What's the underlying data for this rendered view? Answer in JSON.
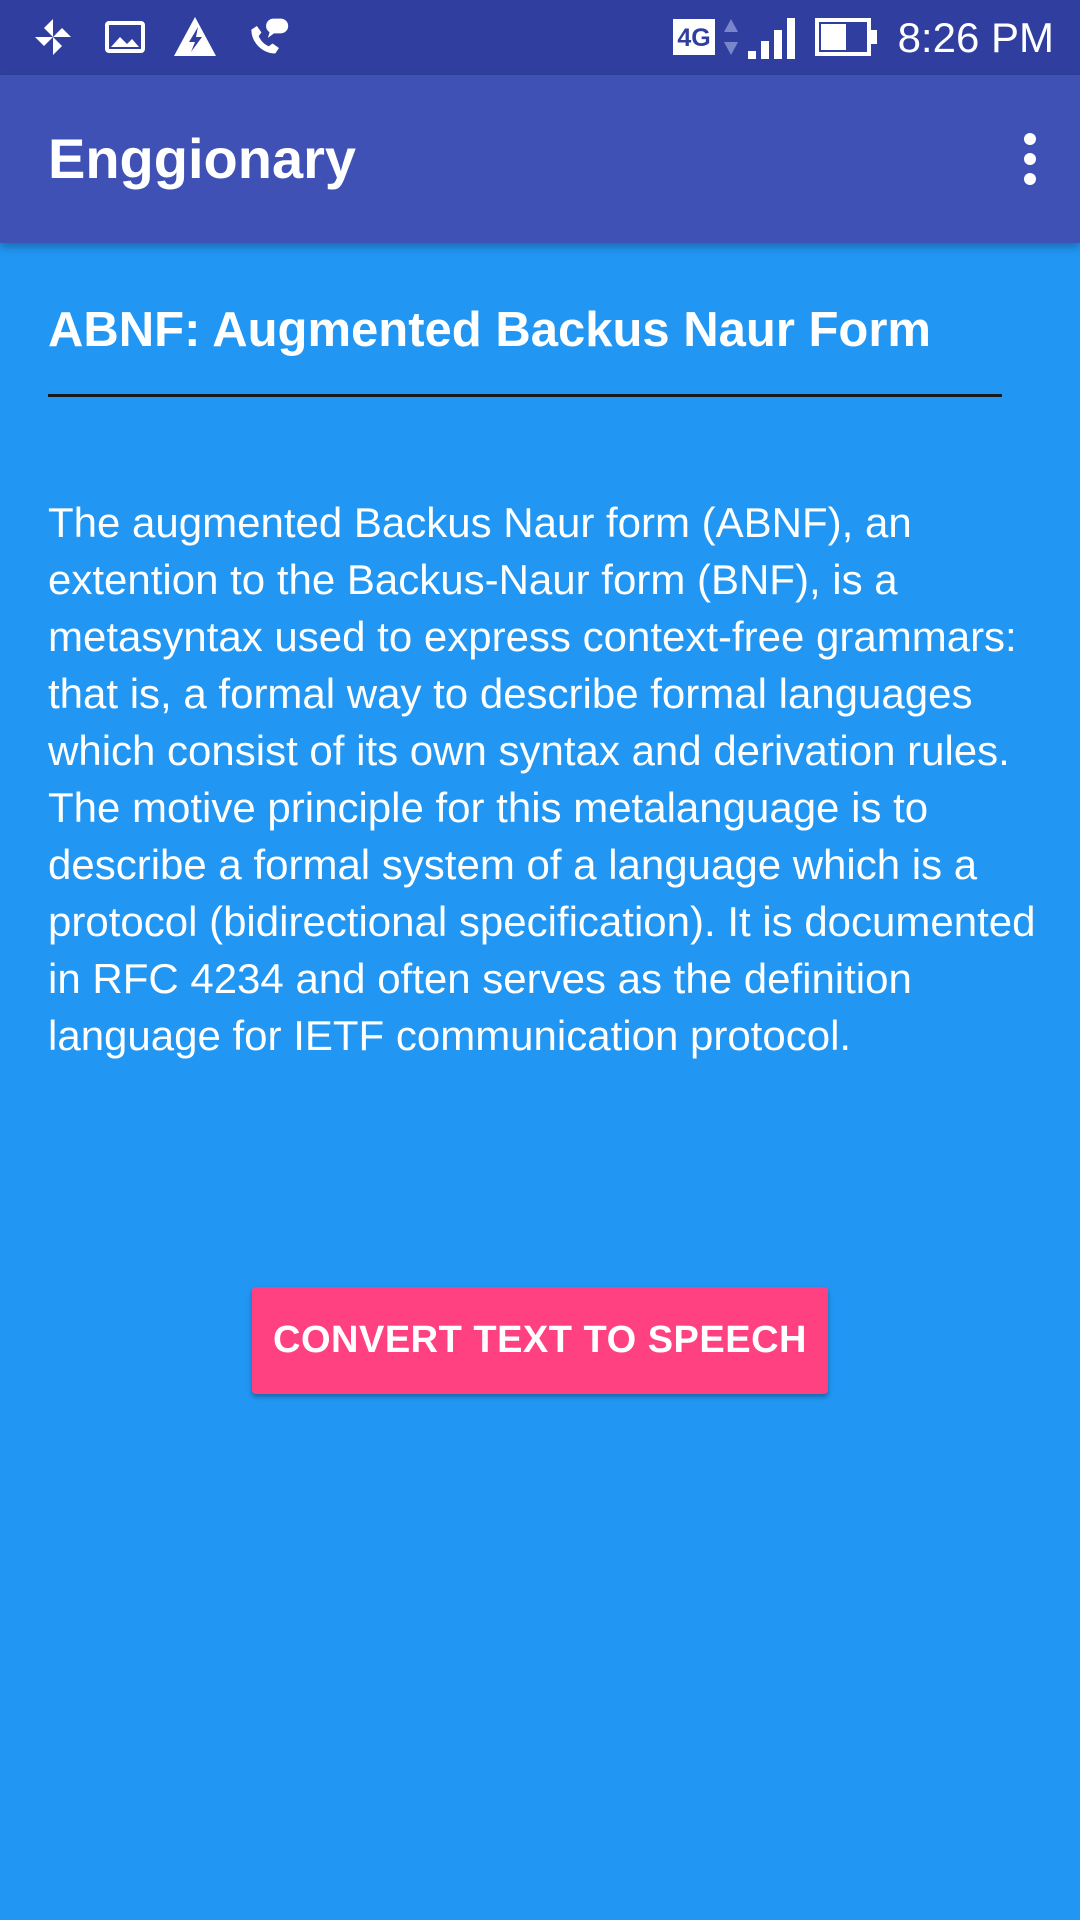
{
  "status_bar": {
    "time": "8:26 PM",
    "network_label": "4G",
    "colors": {
      "background": "#303f9f"
    },
    "icons": [
      "pinwheel-icon",
      "image-icon",
      "warning-icon",
      "call-message-icon",
      "network-4g-icon",
      "signal-icon",
      "battery-icon"
    ]
  },
  "app_bar": {
    "title": "Enggionary",
    "colors": {
      "background": "#3f51b5"
    },
    "icons": [
      "more-vert-icon"
    ]
  },
  "content": {
    "term_title": "ABNF: Augmented Backus Naur Form",
    "definition": "The augmented Backus Naur form (ABNF), an extention to the Backus-Naur form (BNF), is a metasyntax used to express context-free grammars: that is, a formal way to describe formal languages which consist of its own syntax and derivation rules. The motive principle for this metalanguage is to describe a formal system of a language which is a protocol (bidirectional specification). It is documented in RFC 4234 and often serves as the definition language for IETF communication protocol.",
    "colors": {
      "background": "#2196f3",
      "divider": "#1a1a1a"
    }
  },
  "actions": {
    "tts_label": "CONVERT TEXT TO SPEECH",
    "colors": {
      "accent": "#ff4081"
    }
  }
}
